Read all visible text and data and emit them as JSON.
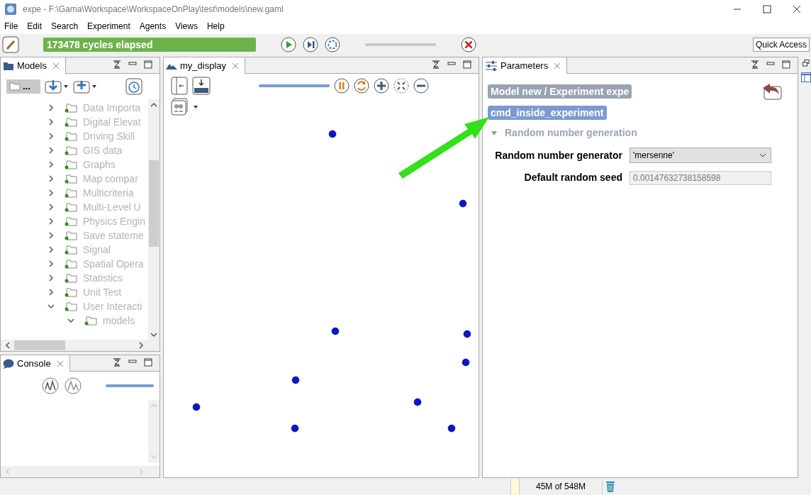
{
  "window": {
    "title": "expe - F:\\Gama\\Workspace\\WorkspaceOnPlay\\test\\models\\new.gaml"
  },
  "menu": [
    "File",
    "Edit",
    "Search",
    "Experiment",
    "Agents",
    "Views",
    "Help"
  ],
  "toolbar": {
    "status": "173478 cycles elapsed",
    "quick_access": "Quick Access"
  },
  "models_view": {
    "tab": {
      "label": "Models",
      "selected": true
    },
    "folder_button": "...",
    "tree": [
      {
        "label": "Data Importa",
        "expanded": false
      },
      {
        "label": "Digital Elevat",
        "expanded": false
      },
      {
        "label": "Driving Skill",
        "expanded": false
      },
      {
        "label": "GIS data",
        "expanded": false
      },
      {
        "label": "Graphs",
        "expanded": false
      },
      {
        "label": "Map compar",
        "expanded": false
      },
      {
        "label": "Multicriteria",
        "expanded": false
      },
      {
        "label": "Multi-Level U",
        "expanded": false
      },
      {
        "label": "Physics Engin",
        "expanded": false
      },
      {
        "label": "Save stateme",
        "expanded": false
      },
      {
        "label": "Signal",
        "expanded": false
      },
      {
        "label": "Spatial Opera",
        "expanded": false
      },
      {
        "label": "Statistics",
        "expanded": false
      },
      {
        "label": "Unit Test",
        "expanded": false
      },
      {
        "label": "User Interacti",
        "expanded": true,
        "children": [
          {
            "label": "models",
            "expanded": true
          }
        ]
      }
    ]
  },
  "console_view": {
    "tab": {
      "label": "Console",
      "selected": true
    },
    "slider": {
      "level": 1
    }
  },
  "display_view": {
    "tab": {
      "label": "my_display",
      "selected": true
    },
    "zoom_slider": {
      "level": 1
    }
  },
  "parameters_view": {
    "tab": {
      "label": "Parameters",
      "selected": true
    },
    "header": "Model new / Experiment expe",
    "command": "cmd_inside_experiment",
    "section": {
      "title": "Random number generation",
      "expanded": true
    },
    "params": [
      {
        "kind": "dropdown",
        "label": "Random number generator",
        "value": "'mersenne'"
      },
      {
        "kind": "text",
        "label": "Default random seed",
        "value": "0.00147632738158598"
      }
    ]
  },
  "status_bar": {
    "memory": "45M of 548M"
  }
}
